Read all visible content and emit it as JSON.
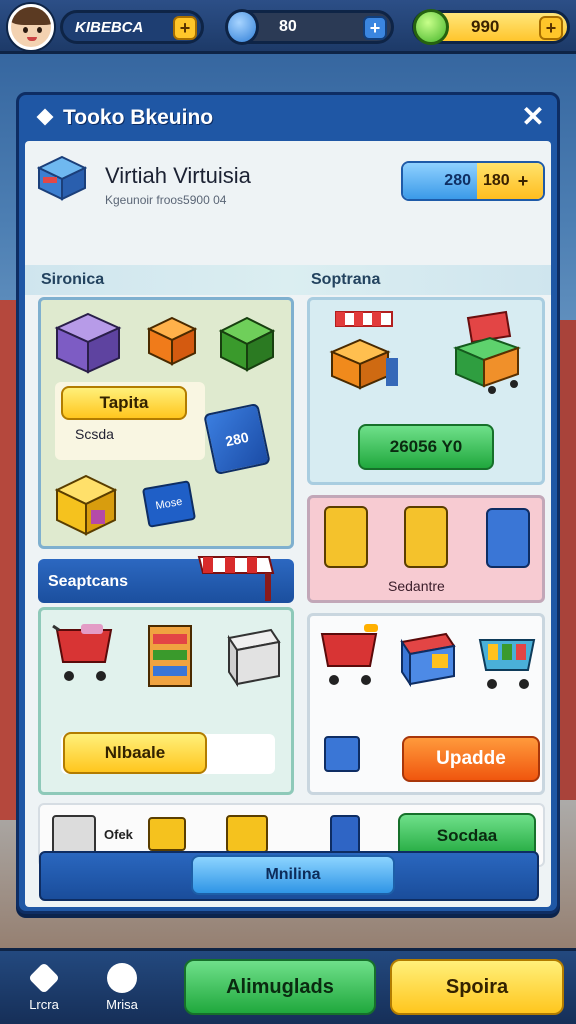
{
  "hud": {
    "player_name": "KIBEBCA",
    "gems": "80",
    "coins": "990",
    "plus": "+"
  },
  "panel": {
    "title": "Tooko Bkeuino",
    "close": "✕"
  },
  "store": {
    "title": "Virtiah Virtuisia",
    "subtitle": "Kgeunoir froos5900 04",
    "counter_a": "280",
    "counter_b": "180",
    "counter_plus": "+"
  },
  "labels": {
    "section1": "Sironica",
    "section2": "Soptrana",
    "section3": "Seaptcans",
    "pink_label": "Sedantre",
    "tile_text": "Ofek"
  },
  "cards": {
    "tag_badge": "Tapita",
    "tag_caption": "Scsda",
    "phone_price": "280",
    "sign_text": "Mose",
    "price_button": "26056 Y0"
  },
  "buttons": {
    "nblaale": "Nlbaale",
    "update": "Upadde",
    "soclaa": "Socdaa",
    "footer": "Mnilina"
  },
  "nav": {
    "left1": "Lrcra",
    "left2": "Mrisa",
    "btn_green": "Alimuglads",
    "btn_orange": "Spoira"
  },
  "colors": {
    "panel": "#1f57a5",
    "accent_yellow": "#ffc62a",
    "accent_green": "#20a83d",
    "accent_orange": "#f0560e"
  }
}
